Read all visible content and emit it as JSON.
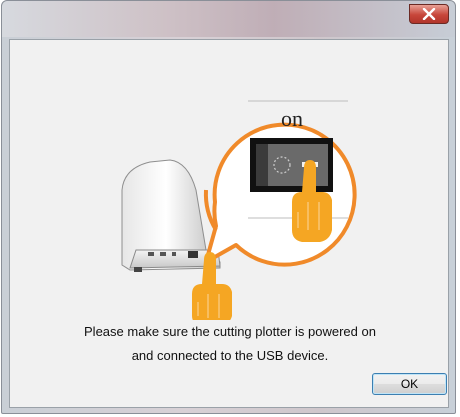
{
  "dialog": {
    "title": "",
    "callout_label": "on",
    "message_line1": "Please make sure the cutting plotter is powered on",
    "message_line2": "and connected to the USB device.",
    "ok_label": "OK"
  },
  "colors": {
    "callout_orange": "#f08a2a",
    "hand_orange": "#f5a623",
    "dialog_bg": "#f1f1f1",
    "button_focus_border": "#3c7fb1"
  },
  "icons": {
    "close": "close-x-icon",
    "hand": "pointing-hand-icon",
    "power_switch": "power-switch-icon",
    "plotter": "cutting-plotter-icon"
  }
}
